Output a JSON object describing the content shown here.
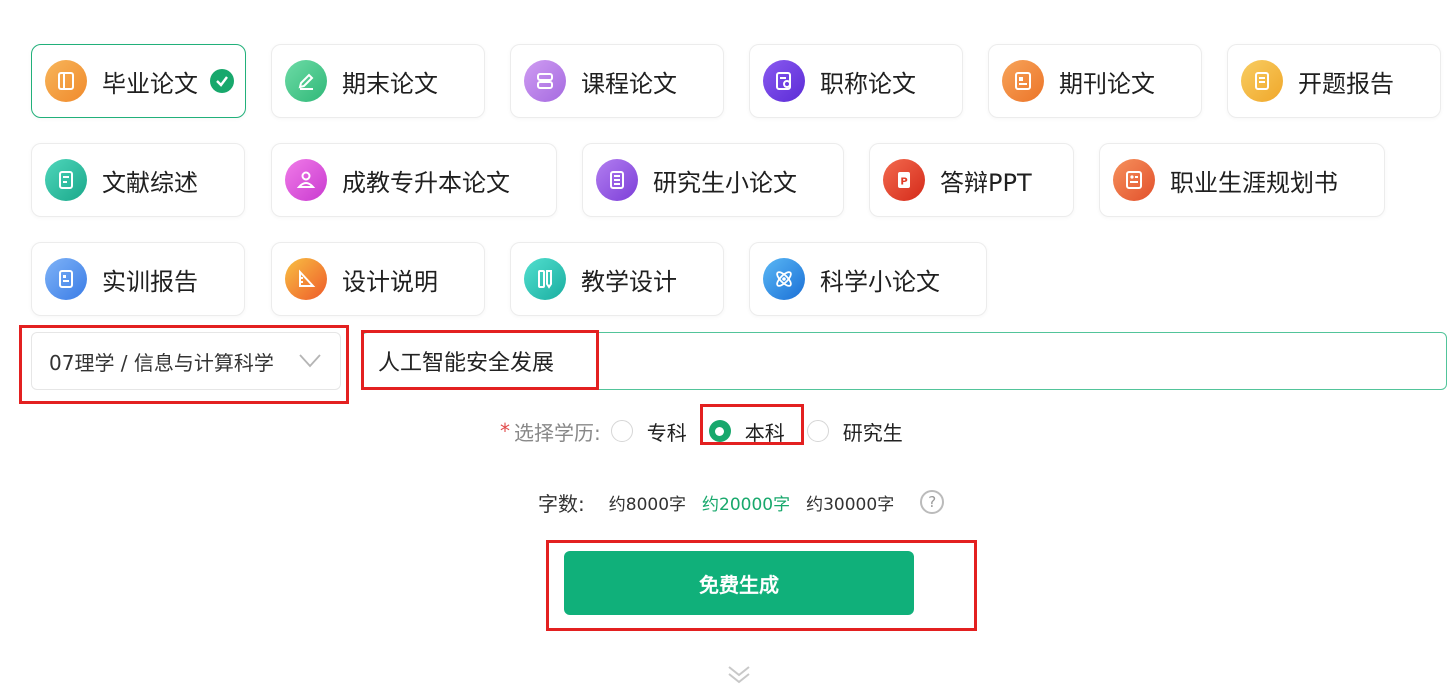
{
  "paper_types": [
    {
      "label": "毕业论文",
      "icon": "thesis-book-icon",
      "color": "#f49a3b",
      "selected": true
    },
    {
      "label": "期末论文",
      "icon": "pen-edit-icon",
      "color": "#43c78a",
      "selected": false
    },
    {
      "label": "课程论文",
      "icon": "course-stack-icon",
      "color": "#b47ce6",
      "selected": false
    },
    {
      "label": "职称论文",
      "icon": "title-certificate-icon",
      "color": "#6e3ee0",
      "selected": false
    },
    {
      "label": "期刊论文",
      "icon": "journal-icon",
      "color": "#f2863a",
      "selected": false
    },
    {
      "label": "开题报告",
      "icon": "proposal-report-icon",
      "color": "#f5bb3e",
      "selected": false
    },
    {
      "label": "文献综述",
      "icon": "literature-review-icon",
      "color": "#27bfa0",
      "selected": false
    },
    {
      "label": "成教专升本论文",
      "icon": "adult-education-icon",
      "color": "#e24fd9",
      "selected": false
    },
    {
      "label": "研究生小论文",
      "icon": "graduate-paper-icon",
      "color": "#9a5ae8",
      "selected": false
    },
    {
      "label": "答辩PPT",
      "icon": "ppt-icon",
      "color": "#ea3f2a",
      "selected": false
    },
    {
      "label": "职业生涯规划书",
      "icon": "career-plan-icon",
      "color": "#ee6a3d",
      "selected": false
    },
    {
      "label": "实训报告",
      "icon": "training-report-icon",
      "color": "#4f8ff0",
      "selected": false
    },
    {
      "label": "设计说明",
      "icon": "design-ruler-icon",
      "color": "#f26d2e",
      "selected": false
    },
    {
      "label": "教学设计",
      "icon": "teaching-design-icon",
      "color": "#25c7b5",
      "selected": false
    },
    {
      "label": "科学小论文",
      "icon": "atom-science-icon",
      "color": "#2c8de8",
      "selected": false
    }
  ],
  "subject_select": {
    "value": "07理学 / 信息与计算科学"
  },
  "topic_input": {
    "value": "人工智能安全发展"
  },
  "education": {
    "required_mark": "*",
    "label": "选择学历:",
    "options": [
      {
        "label": "专科",
        "selected": false
      },
      {
        "label": "本科",
        "selected": true
      },
      {
        "label": "研究生",
        "selected": false
      }
    ]
  },
  "word_count": {
    "label": "字数:",
    "options": [
      {
        "label": "约8000字",
        "selected": false
      },
      {
        "label": "约20000字",
        "selected": true
      },
      {
        "label": "约30000字",
        "selected": false
      }
    ],
    "help_symbol": "?"
  },
  "generate_button": {
    "label": "免费生成"
  },
  "colors": {
    "accent": "#18a86c",
    "button": "#10b07a",
    "highlight": "#e32020"
  }
}
